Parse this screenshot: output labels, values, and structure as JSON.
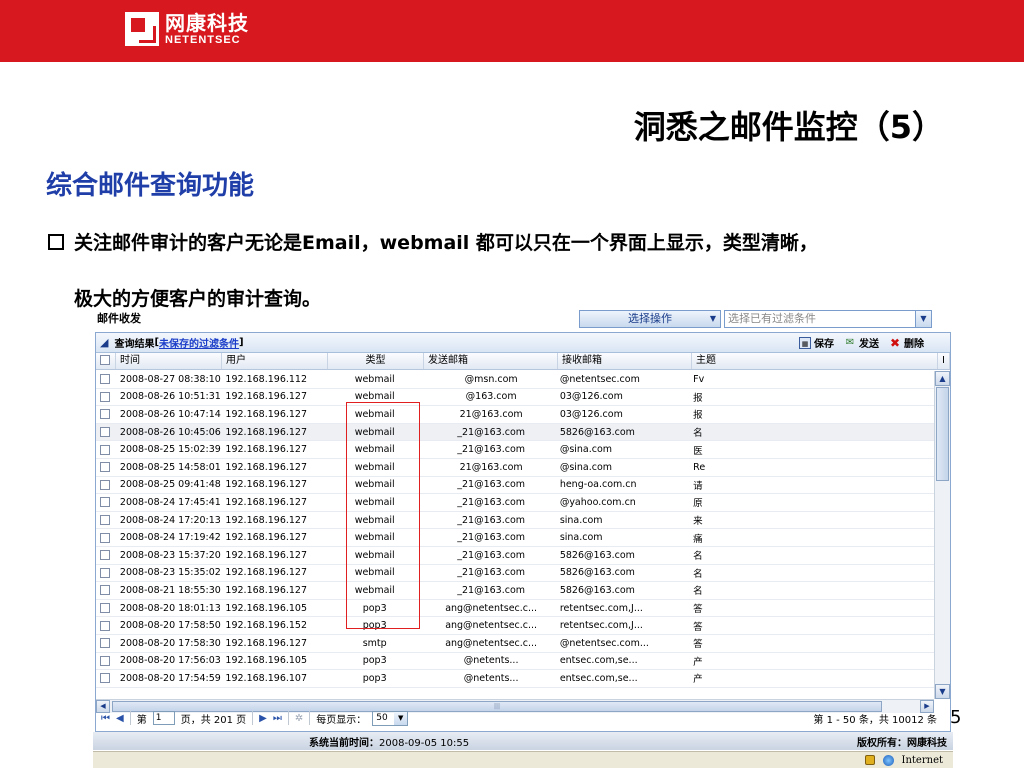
{
  "brand": {
    "name_cn": "网康科技",
    "name_en": "NETENTSEC"
  },
  "slide": {
    "title": "洞悉之邮件监控（5）",
    "section": "综合邮件查询功能",
    "bullet_line1": "关注邮件审计的客户无论是Email，webmail 都可以只在一个界面上显示，类型清晰，",
    "bullet_line2": "极大的方便客户的审计查询。",
    "page_number": "5"
  },
  "app": {
    "title": "邮件收发",
    "op_select": "选择操作",
    "filter_placeholder": "选择已有过滤条件",
    "panel_title": "查询结果",
    "panel_link": "未保存的过滤条件",
    "panel_bracket_open": "[",
    "panel_bracket_close": "]",
    "toolbar": {
      "save": "保存",
      "send": "发送",
      "delete": "删除"
    },
    "columns": {
      "time": "时间",
      "user": "用户",
      "type": "类型",
      "from": "发送邮箱",
      "to": "接收邮箱",
      "subject": "主题",
      "extra": "I"
    },
    "rows": [
      {
        "time": "2008-08-27 08:38:10",
        "user": "192.168.196.112",
        "type": "webmail",
        "from": "@msn.com",
        "to": "@netentsec.com",
        "subject": "Fv"
      },
      {
        "time": "2008-08-26 10:51:31",
        "user": "192.168.196.127",
        "type": "webmail",
        "from": "@163.com",
        "to": "03@126.com",
        "subject": "报"
      },
      {
        "time": "2008-08-26 10:47:14",
        "user": "192.168.196.127",
        "type": "webmail",
        "from": "21@163.com",
        "to": "03@126.com",
        "subject": "报"
      },
      {
        "time": "2008-08-26 10:45:06",
        "user": "192.168.196.127",
        "type": "webmail",
        "from": "_21@163.com",
        "to": "5826@163.com",
        "subject": "名"
      },
      {
        "time": "2008-08-25 15:02:39",
        "user": "192.168.196.127",
        "type": "webmail",
        "from": "_21@163.com",
        "to": "@sina.com",
        "subject": "医"
      },
      {
        "time": "2008-08-25 14:58:01",
        "user": "192.168.196.127",
        "type": "webmail",
        "from": "21@163.com",
        "to": "@sina.com",
        "subject": "Re"
      },
      {
        "time": "2008-08-25 09:41:48",
        "user": "192.168.196.127",
        "type": "webmail",
        "from": "_21@163.com",
        "to": "heng-oa.com.cn",
        "subject": "请"
      },
      {
        "time": "2008-08-24 17:45:41",
        "user": "192.168.196.127",
        "type": "webmail",
        "from": "_21@163.com",
        "to": "@yahoo.com.cn",
        "subject": "原"
      },
      {
        "time": "2008-08-24 17:20:13",
        "user": "192.168.196.127",
        "type": "webmail",
        "from": "_21@163.com",
        "to": "sina.com",
        "subject": "来"
      },
      {
        "time": "2008-08-24 17:19:42",
        "user": "192.168.196.127",
        "type": "webmail",
        "from": "_21@163.com",
        "to": "sina.com",
        "subject": "痛"
      },
      {
        "time": "2008-08-23 15:37:20",
        "user": "192.168.196.127",
        "type": "webmail",
        "from": "_21@163.com",
        "to": "5826@163.com",
        "subject": "名"
      },
      {
        "time": "2008-08-23 15:35:02",
        "user": "192.168.196.127",
        "type": "webmail",
        "from": "_21@163.com",
        "to": "5826@163.com",
        "subject": "名"
      },
      {
        "time": "2008-08-21 18:55:30",
        "user": "192.168.196.127",
        "type": "webmail",
        "from": "_21@163.com",
        "to": "5826@163.com",
        "subject": "名"
      },
      {
        "time": "2008-08-20 18:01:13",
        "user": "192.168.196.105",
        "type": "pop3",
        "from": "ang@netentsec.c...",
        "to": "retentsec.com,J...",
        "subject": "答"
      },
      {
        "time": "2008-08-20 17:58:50",
        "user": "192.168.196.152",
        "type": "pop3",
        "from": "ang@netentsec.c...",
        "to": "retentsec.com,J...",
        "subject": "答"
      },
      {
        "time": "2008-08-20 17:58:30",
        "user": "192.168.196.127",
        "type": "smtp",
        "from": "ang@netentsec.c...",
        "to": "@netentsec.com...",
        "subject": "答"
      },
      {
        "time": "2008-08-20 17:56:03",
        "user": "192.168.196.105",
        "type": "pop3",
        "from": "@netents...",
        "to": "entsec.com,se...",
        "subject": "产"
      },
      {
        "time": "2008-08-20 17:54:59",
        "user": "192.168.196.107",
        "type": "pop3",
        "from": "@netents...",
        "to": "entsec.com,se...",
        "subject": "产"
      }
    ],
    "pager": {
      "page_prefix": "第",
      "current_page": "1",
      "page_suffix": "页，共 201 页",
      "per_page_label": "每页显示：",
      "per_page": "50",
      "summary": "第 1 - 50 条，共 10012 条"
    },
    "status": {
      "time_label": "系统当前时间：",
      "time_value": "2008-09-05 10:55",
      "copyright": "版权所有：网康科技"
    },
    "ie": {
      "zone": "Internet"
    }
  },
  "colors": {
    "brand_red": "#d7191f",
    "section_blue": "#1f3ea8",
    "highlight_red": "#e02020"
  }
}
